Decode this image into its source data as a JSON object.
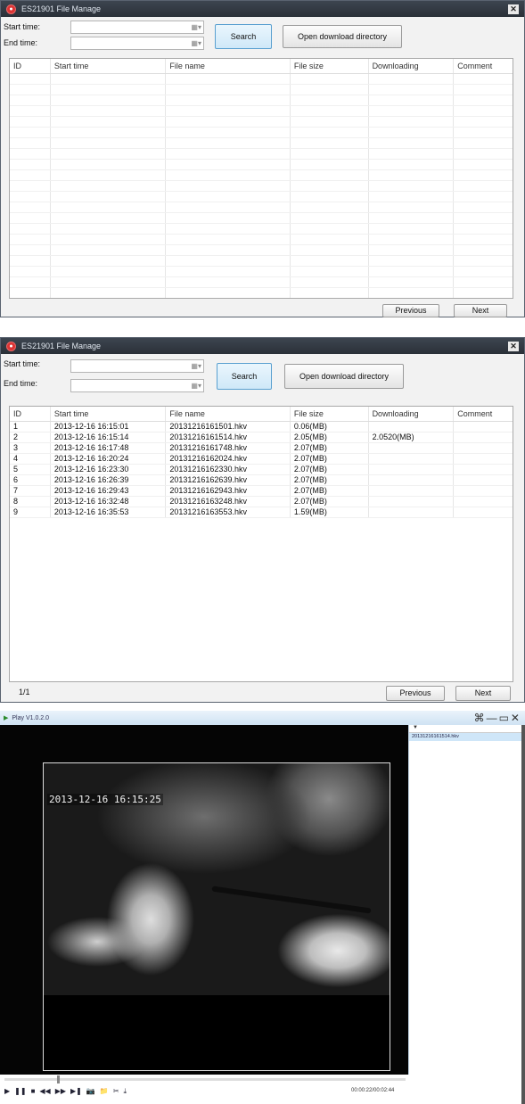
{
  "window1": {
    "title": "ES21901 File Manage",
    "close": "✕",
    "start_label": "Start time:",
    "end_label": "End time:",
    "dropdown_glyph": "▦▾",
    "search": "Search",
    "open_dir": "Open download directory",
    "columns": [
      "ID",
      "Start time",
      "File name",
      "File size",
      "Downloading",
      "Comment"
    ],
    "previous": "Previous",
    "next": "Next"
  },
  "window2": {
    "title": "ES21901 File Manage",
    "close": "✕",
    "start_label": "Start time:",
    "end_label": "End time:",
    "dropdown_glyph": "▦▾",
    "search": "Search",
    "open_dir": "Open download directory",
    "columns": [
      "ID",
      "Start time",
      "File name",
      "File size",
      "Downloading",
      "Comment"
    ],
    "rows": [
      {
        "id": "1",
        "start": "2013-12-16 16:15:01",
        "file": "20131216161501.hkv",
        "size": "0.06(MB)",
        "downloading": "",
        "comment": ""
      },
      {
        "id": "2",
        "start": "2013-12-16 16:15:14",
        "file": "20131216161514.hkv",
        "size": "2.05(MB)",
        "downloading": "2.0520(MB)",
        "comment": ""
      },
      {
        "id": "3",
        "start": "2013-12-16 16:17:48",
        "file": "20131216161748.hkv",
        "size": "2.07(MB)",
        "downloading": "",
        "comment": ""
      },
      {
        "id": "4",
        "start": "2013-12-16 16:20:24",
        "file": "20131216162024.hkv",
        "size": "2.07(MB)",
        "downloading": "",
        "comment": ""
      },
      {
        "id": "5",
        "start": "2013-12-16 16:23:30",
        "file": "20131216162330.hkv",
        "size": "2.07(MB)",
        "downloading": "",
        "comment": ""
      },
      {
        "id": "6",
        "start": "2013-12-16 16:26:39",
        "file": "20131216162639.hkv",
        "size": "2.07(MB)",
        "downloading": "",
        "comment": ""
      },
      {
        "id": "7",
        "start": "2013-12-16 16:29:43",
        "file": "20131216162943.hkv",
        "size": "2.07(MB)",
        "downloading": "",
        "comment": ""
      },
      {
        "id": "8",
        "start": "2013-12-16 16:32:48",
        "file": "20131216163248.hkv",
        "size": "2.07(MB)",
        "downloading": "",
        "comment": ""
      },
      {
        "id": "9",
        "start": "2013-12-16 16:35:53",
        "file": "20131216163553.hkv",
        "size": "1.59(MB)",
        "downloading": "",
        "comment": ""
      }
    ],
    "page": "1/1",
    "previous": "Previous",
    "next": "Next"
  },
  "player": {
    "title": "Play V1.0.2.0",
    "window_controls": "⌘—▭✕",
    "osd_timestamp": "2013-12-16 16:15:25",
    "playlist_header": "▼",
    "playlist_items": [
      "20131216161514.hkv"
    ],
    "controls": [
      "▶",
      "❚❚",
      "■",
      "◀◀",
      "▶▶",
      "▶❚",
      "📷",
      "📁",
      "✂",
      "⤓"
    ],
    "time": "00:00:22/00:02:44",
    "seek_fraction": 0.13
  }
}
